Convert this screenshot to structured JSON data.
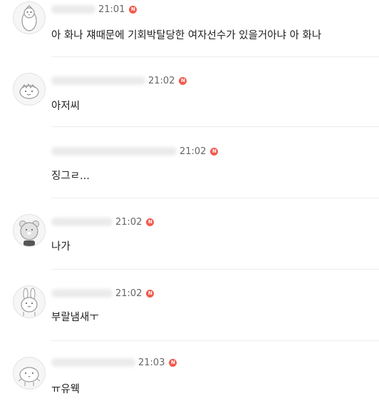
{
  "comments": [
    {
      "avatar": "penguin-avatar-icon",
      "time": "21:01",
      "badge": "N",
      "text": "아 화나 쟤때문에 기회박탈당한 여자선수가 있을거아냐 아 화나"
    },
    {
      "avatar": "dinosaur-avatar-icon",
      "time": "21:02",
      "badge": "N",
      "text": "아저씨"
    },
    {
      "avatar": "blank-avatar-icon",
      "time": "21:02",
      "badge": "N",
      "text": "징그ㄹ..."
    },
    {
      "avatar": "bear-avatar-icon",
      "time": "21:02",
      "badge": "N",
      "text": "나가"
    },
    {
      "avatar": "rabbit-avatar-icon",
      "time": "21:02",
      "badge": "N",
      "text": "부랄냄새ㅜ"
    },
    {
      "avatar": "chick-avatar-icon",
      "time": "21:03",
      "badge": "N",
      "text": "ㅠ유웩"
    }
  ],
  "colors": {
    "badge": "#f15b4e",
    "time": "#666666",
    "text": "#222222",
    "divider": "#ececec"
  }
}
